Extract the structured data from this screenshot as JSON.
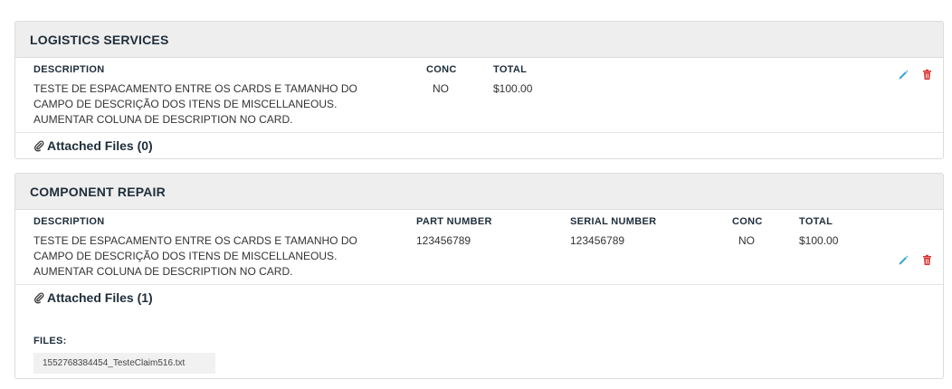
{
  "logistics": {
    "title": "LOGISTICS SERVICES",
    "columns": {
      "description": "DESCRIPTION",
      "conc": "CONC",
      "total": "TOTAL"
    },
    "item": {
      "description": "TESTE DE ESPACAMENTO ENTRE OS CARDS E TAMANHO DO CAMPO DE DESCRIÇÃO DOS ITENS DE MISCELLANEOUS. AUMENTAR COLUNA DE DESCRIPTION NO CARD.",
      "conc": "NO",
      "total": "$100.00"
    },
    "attached_files_label": "Attached Files (0)"
  },
  "component_repair": {
    "title": "COMPONENT REPAIR",
    "columns": {
      "description": "DESCRIPTION",
      "part_number": "PART NUMBER",
      "serial_number": "SERIAL NUMBER",
      "conc": "CONC",
      "total": "TOTAL"
    },
    "item": {
      "description": "TESTE DE ESPACAMENTO ENTRE OS CARDS E TAMANHO DO CAMPO DE DESCRIÇÃO DOS ITENS DE MISCELLANEOUS. AUMENTAR COLUNA DE DESCRIPTION NO CARD.",
      "part_number": "123456789",
      "serial_number": "123456789",
      "conc": "NO",
      "total": "$100.00"
    },
    "attached_files_label": "Attached Files (1)",
    "files_label": "FILES:",
    "files": [
      "1552768384454_TesteClaim516.txt"
    ]
  },
  "icons": {
    "edit": "pencil-icon",
    "delete": "trash-icon",
    "attachment": "paperclip-icon"
  },
  "colors": {
    "edit": "#3aa8d8",
    "delete": "#d9302c",
    "header_bg": "#eeeeee",
    "title": "#1e2d3b"
  }
}
